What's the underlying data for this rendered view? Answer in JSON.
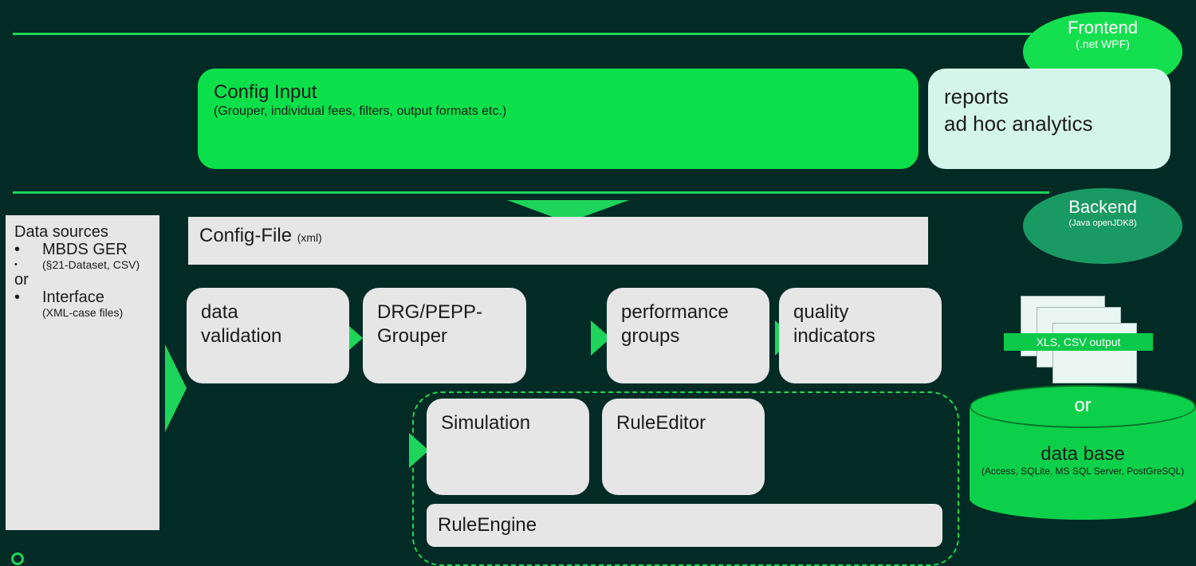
{
  "frontend": {
    "title": "Frontend",
    "subtitle": "(.net WPF)"
  },
  "backend": {
    "title": "Backend",
    "subtitle": "(Java openJDK8)"
  },
  "config_input": {
    "title": "Config Input",
    "subtitle": "(Grouper, individual fees, filters, output formats etc.)"
  },
  "reports": {
    "line1": "reports",
    "line2": "ad hoc analytics"
  },
  "config_file": {
    "title": "Config-File",
    "suffix": "(xml)"
  },
  "data_sources": {
    "title": "Data sources",
    "item1": "MBDS GER",
    "item1_note": "(§21-Dataset, CSV)",
    "or": "or",
    "item2": "Interface",
    "item2_note": "(XML-case files)",
    "bullet": "•"
  },
  "modules": {
    "data_validation": {
      "line1": "data",
      "line2": "validation"
    },
    "grouper": {
      "line1": "DRG/PEPP-",
      "line2": "Grouper"
    },
    "performance_groups": {
      "line1": "performance",
      "line2": "groups"
    },
    "quality_indicators": {
      "line1": "quality",
      "line2": "indicators"
    },
    "simulation": "Simulation",
    "rule_editor": "RuleEditor",
    "rule_engine": "RuleEngine"
  },
  "output": {
    "files_label": "XLS, CSV output",
    "or": "or",
    "database_title": "data base",
    "database_note": "(Access, SQLite, MS SQL Server, PostGreSQL)"
  },
  "colors": {
    "background": "#022b25",
    "accent": "#1fd45a",
    "config_input": "#0be04a",
    "frontend_oval": "#14e04f",
    "backend_oval": "#1a9a63",
    "box_gray": "#e6e6e6",
    "reports": "#d4f5ea"
  }
}
